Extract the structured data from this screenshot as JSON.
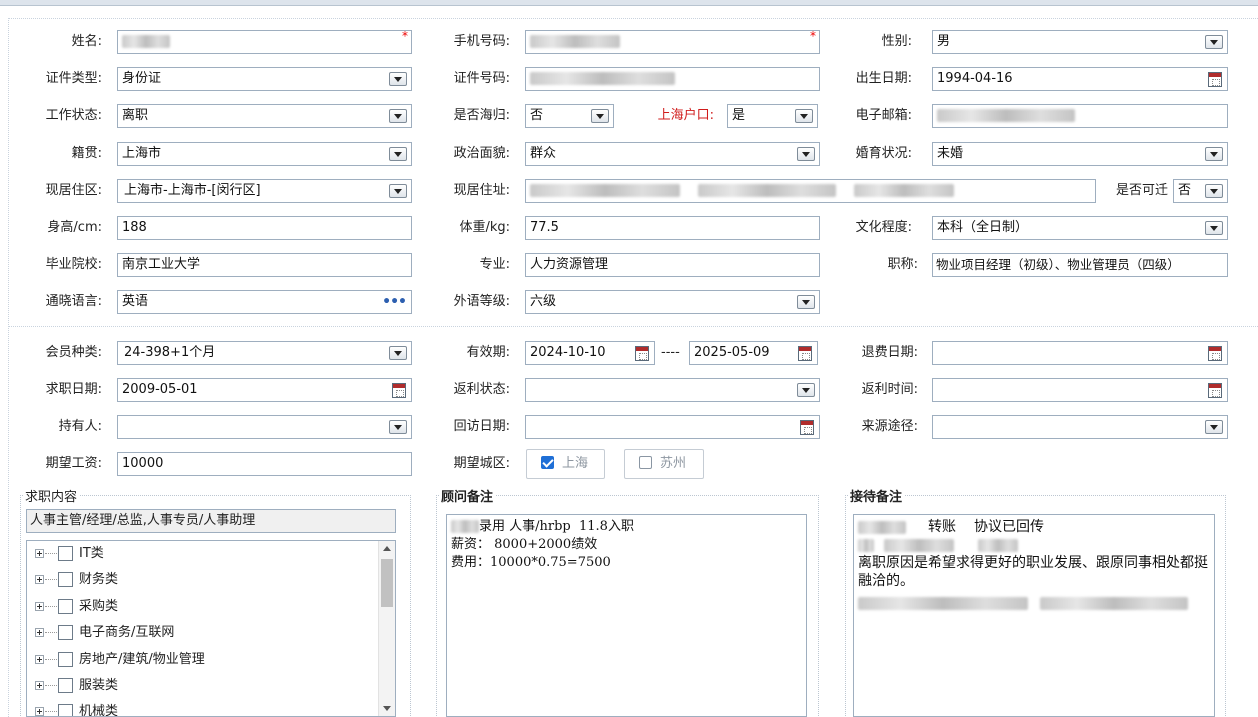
{
  "profile": {
    "name": {
      "label": "姓名:",
      "value": ""
    },
    "mobile": {
      "label": "手机号码:",
      "value": ""
    },
    "gender": {
      "label": "性别:",
      "value": "男"
    },
    "id_type": {
      "label": "证件类型:",
      "value": "身份证"
    },
    "id_number": {
      "label": "证件号码:",
      "value": ""
    },
    "birth_date": {
      "label": "出生日期:",
      "value": "1994-04-16"
    },
    "work_status": {
      "label": "工作状态:",
      "value": "离职"
    },
    "returnee": {
      "label": "是否海归:",
      "value": "否"
    },
    "shanghai_hukou": {
      "label": "上海户口:",
      "value": "是"
    },
    "email": {
      "label": "电子邮箱:",
      "value": ""
    },
    "native_place": {
      "label": "籍贯:",
      "value": "上海市"
    },
    "political_status": {
      "label": "政治面貌:",
      "value": "群众"
    },
    "marital_status": {
      "label": "婚育状况:",
      "value": "未婚"
    },
    "residence_area": {
      "label": "现居住区:",
      "value": "上海市-上海市-[闵行区]"
    },
    "residence_address": {
      "label": "现居住址:",
      "value": ""
    },
    "relocatable": {
      "label": "是否可迁",
      "value": "否"
    },
    "height": {
      "label": "身高/cm:",
      "value": "188"
    },
    "weight": {
      "label": "体重/kg:",
      "value": "77.5"
    },
    "education": {
      "label": "文化程度:",
      "value": "本科（全日制）"
    },
    "school": {
      "label": "毕业院校:",
      "value": "南京工业大学"
    },
    "major": {
      "label": "专业:",
      "value": "人力资源管理"
    },
    "title": {
      "label": "职称:",
      "value": "物业项目经理（初级）、物业管理员（四级）"
    },
    "language": {
      "label": "通晓语言:",
      "value": "英语",
      "button": "•••"
    },
    "language_level": {
      "label": "外语等级:",
      "value": "六级"
    }
  },
  "membership": {
    "member_type": {
      "label": "会员种类:",
      "value": "24-398+1个月"
    },
    "validity": {
      "label": "有效期:",
      "start": "2024-10-10",
      "separator": "----",
      "end": "2025-05-09"
    },
    "refund_date": {
      "label": "退费日期:",
      "value": ""
    },
    "job_search_date": {
      "label": "求职日期:",
      "value": "2009-05-01"
    },
    "rebate_status": {
      "label": "返利状态:",
      "value": ""
    },
    "rebate_time": {
      "label": "返利时间:",
      "value": ""
    },
    "holder": {
      "label": "持有人:",
      "value": ""
    },
    "return_visit_date": {
      "label": "回访日期:",
      "value": ""
    },
    "source": {
      "label": "来源途径:",
      "value": ""
    },
    "expected_salary": {
      "label": "期望工资:",
      "value": "10000"
    },
    "expected_city": {
      "label": "期望城区:",
      "options": [
        {
          "label": "上海",
          "checked": true
        },
        {
          "label": "苏州",
          "checked": false
        }
      ]
    }
  },
  "job_panel": {
    "legend": "求职内容",
    "selected": "人事主管/经理/总监,人事专员/人事助理",
    "tree": [
      "IT类",
      "财务类",
      "采购类",
      "电子商务/互联网",
      "房地产/建筑/物业管理",
      "服装类",
      "机械类"
    ]
  },
  "consultant_panel": {
    "legend": "顾问备注",
    "text_line1": "录用 人事/hrbp  11.8入职",
    "text_line2": "薪资： 8000+2000绩效",
    "text_line3": "费用：10000*0.75=7500"
  },
  "reception_panel": {
    "legend": "接待备注",
    "text_line1a": "转账",
    "text_line1b": "协议已回传",
    "text_line3": "离职原因是希望求得更好的职业发展、跟原同事相处都挺融洽的。"
  }
}
